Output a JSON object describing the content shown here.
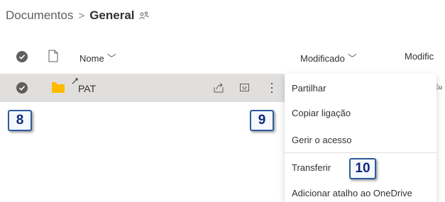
{
  "breadcrumb": {
    "root": "Documentos",
    "separator": ">",
    "current": "General"
  },
  "columns": {
    "name": "Nome",
    "modified": "Modificado",
    "modified_by": "Modific"
  },
  "row": {
    "name": "PAT",
    "modified_by_cut": "Eu"
  },
  "context_menu": {
    "items": [
      "Partilhar",
      "Copiar ligação",
      "Gerir o acesso",
      "Transferir",
      "Adicionar atalho ao OneDrive"
    ]
  },
  "callouts": {
    "a": "8",
    "b": "9",
    "c": "10"
  },
  "icons": {
    "breadcrumb_share": "people-share-icon",
    "header_check": "check-circle-icon",
    "header_file": "file-icon",
    "row_check": "check-circle-icon",
    "folder": "folder-icon",
    "share": "share-icon",
    "copy_link": "link-icon",
    "more": "more-vertical-icon"
  },
  "colors": {
    "selected_row": "#e1dfdd",
    "folder": "#ffb900",
    "callout_border": "#2e5c9a"
  }
}
